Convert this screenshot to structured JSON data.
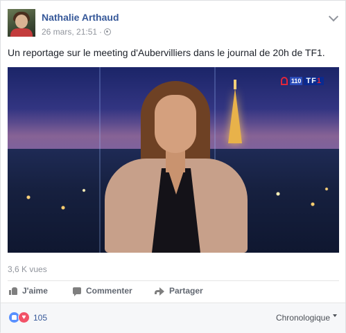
{
  "post": {
    "author": "Nathalie Arthaud",
    "date": "26 mars, 21:51",
    "separator": "·",
    "privacy_icon": "globe-icon",
    "text": "Un reportage sur le meeting d'Aubervilliers dans le journal de 20h de TF1."
  },
  "video": {
    "channel_number": "110",
    "channel_brand_prefix": "TF",
    "channel_brand_suffix": "1"
  },
  "stats": {
    "views": "3,6 K vues"
  },
  "actions": {
    "like_label": "J'aime",
    "comment_label": "Commenter",
    "share_label": "Partager"
  },
  "reactions": {
    "count": "105",
    "sort_label": "Chronologique"
  },
  "colors": {
    "link_blue": "#365899",
    "like_blue": "#5890ff",
    "love_red": "#f25268"
  }
}
